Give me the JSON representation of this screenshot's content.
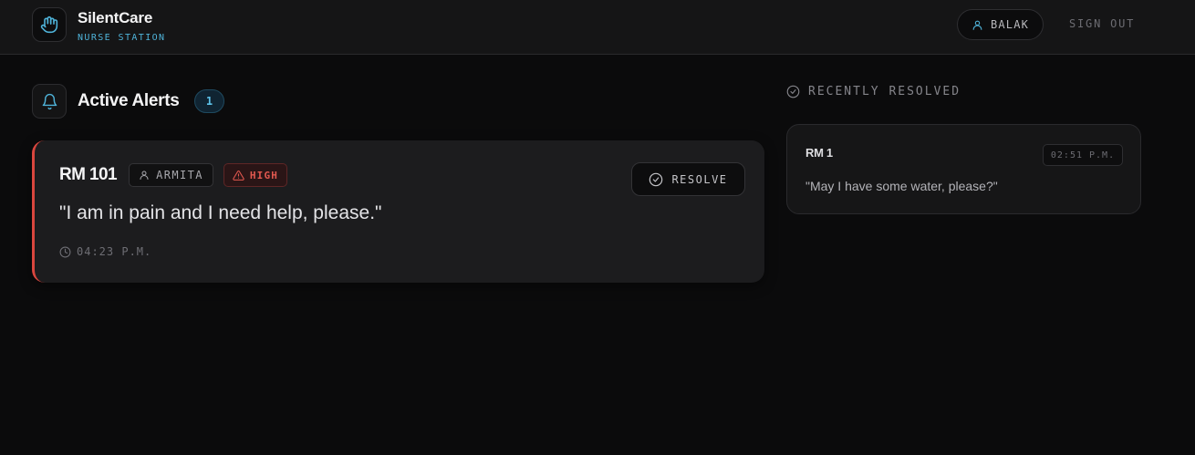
{
  "app": {
    "title": "SilentCare",
    "subtitle": "NURSE STATION",
    "logo_icon": "hand-icon"
  },
  "header": {
    "user_name": "BALAK",
    "sign_out_label": "SIGN OUT"
  },
  "active_alerts": {
    "title": "Active Alerts",
    "count": "1",
    "items": [
      {
        "room": "RM 101",
        "patient": "ARMITA",
        "priority": "HIGH",
        "resolve_label": "RESOLVE",
        "message": "\"I am in pain and I need help, please.\"",
        "time": "04:23 P.M."
      }
    ]
  },
  "recently_resolved": {
    "title": "RECENTLY RESOLVED",
    "items": [
      {
        "room": "RM 1",
        "time": "02:51 P.M.",
        "message": "\"May I have some water, please?\""
      }
    ]
  },
  "colors": {
    "accent": "#4fb3d9",
    "alert_high": "#d9463e",
    "background": "#0b0b0c",
    "card": "#1c1c1e"
  }
}
